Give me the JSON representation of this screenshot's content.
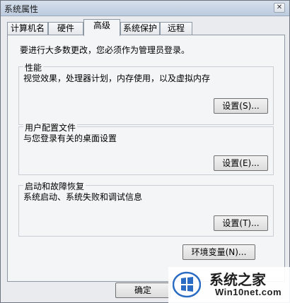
{
  "window": {
    "title": "系统属性",
    "close_glyph": "✕"
  },
  "tabs": [
    {
      "label": "计算机名",
      "active": false
    },
    {
      "label": "硬件",
      "active": false
    },
    {
      "label": "高级",
      "active": true
    },
    {
      "label": "系统保护",
      "active": false
    },
    {
      "label": "远程",
      "active": false
    }
  ],
  "panel": {
    "intro": "要进行大多数更改，您必须作为管理员登录。",
    "performance": {
      "label": "性能",
      "desc": "视觉效果，处理器计划，内存使用，以及虚拟内存",
      "button": "设置(S)..."
    },
    "profiles": {
      "label": "用户配置文件",
      "desc": "与您登录有关的桌面设置",
      "button": "设置(E)..."
    },
    "startup": {
      "label": "启动和故障恢复",
      "desc": "系统启动、系统失败和调试信息",
      "button": "设置(T)..."
    },
    "env_button": "环境变量(N)..."
  },
  "footer": {
    "ok": "确定"
  },
  "watermark": {
    "title": "系统之家",
    "subtitle": "Win10net.com"
  }
}
